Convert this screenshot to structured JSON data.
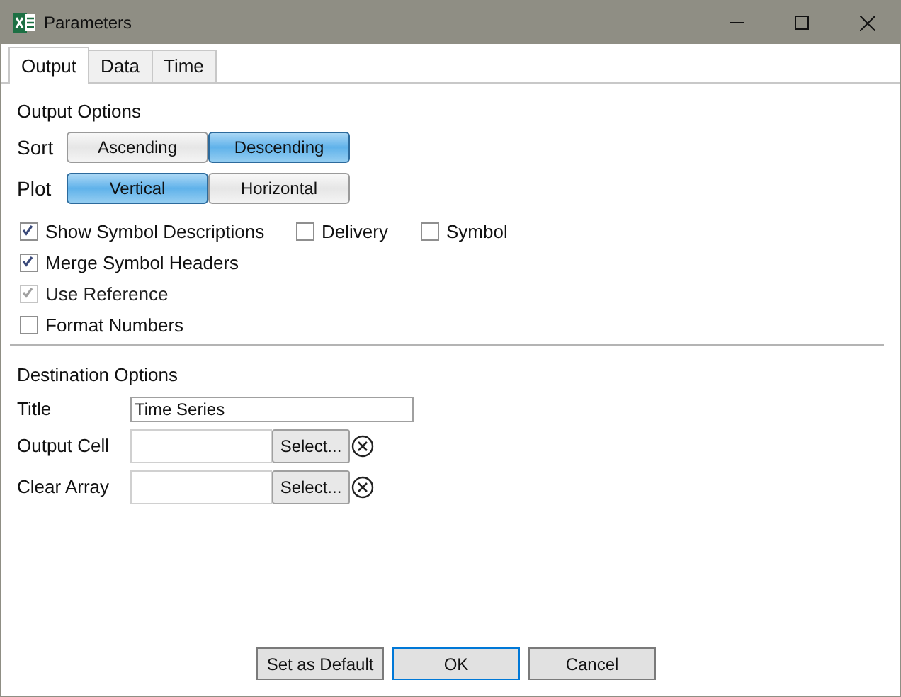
{
  "window": {
    "title": "Parameters"
  },
  "tabs": [
    {
      "label": "Output",
      "selected": true
    },
    {
      "label": "Data",
      "selected": false
    },
    {
      "label": "Time",
      "selected": false
    }
  ],
  "output_options": {
    "heading": "Output Options",
    "toggles": [
      {
        "label": "Sort",
        "options": [
          {
            "label": "Ascending",
            "selected": false
          },
          {
            "label": "Descending",
            "selected": true
          }
        ]
      },
      {
        "label": "Plot",
        "options": [
          {
            "label": "Vertical",
            "selected": true
          },
          {
            "label": "Horizontal",
            "selected": false
          }
        ]
      }
    ],
    "checkbox_rows": [
      [
        {
          "label": "Show Symbol Descriptions",
          "checked": true,
          "disabled": false
        },
        {
          "label": "Delivery",
          "checked": false,
          "disabled": false
        },
        {
          "label": "Symbol",
          "checked": false,
          "disabled": false
        }
      ],
      [
        {
          "label": "Merge Symbol Headers",
          "checked": true,
          "disabled": false
        }
      ],
      [
        {
          "label": "Use Reference",
          "checked": true,
          "disabled": true
        }
      ],
      [
        {
          "label": "Format Numbers",
          "checked": false,
          "disabled": false
        }
      ]
    ]
  },
  "destination_options": {
    "heading": "Destination Options",
    "fields": [
      {
        "kind": "text",
        "label": "Title",
        "value": "Time Series"
      },
      {
        "kind": "range",
        "label": "Output Cell",
        "button": "Select..."
      },
      {
        "kind": "range",
        "label": "Clear Array",
        "button": "Select..."
      }
    ]
  },
  "buttons": [
    {
      "label": "Set as Default",
      "selected": false
    },
    {
      "label": "OK",
      "selected": true
    },
    {
      "label": "Cancel",
      "selected": false
    }
  ]
}
